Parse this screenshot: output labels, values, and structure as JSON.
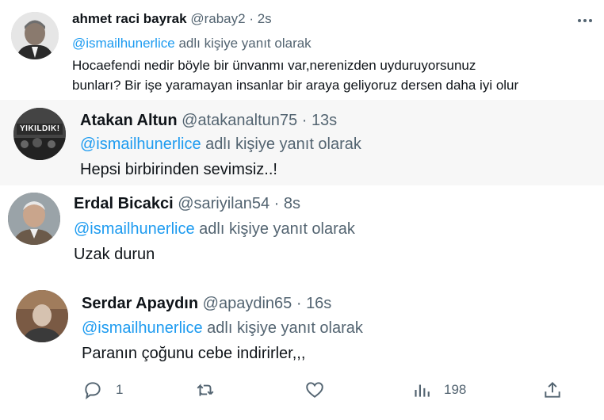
{
  "posts": [
    {
      "name": "ahmet raci bayrak",
      "handle": "@rabay2",
      "time": "2s",
      "reply_to": "@ismailhunerlice",
      "reply_suffix": "adlı kişiye yanıt olarak",
      "text_lines": [
        "Hocaefendi nedir böyle bir ünvanmı var,nerenizden uyduruyorsunuz",
        "bunları? Bir işe yaramayan insanlar bir araya geliyoruz dersen daha iyi olur"
      ]
    },
    {
      "name": "Atakan Altun",
      "handle": "@atakanaltun75",
      "time": "13s",
      "reply_to": "@ismailhunerlice",
      "reply_suffix": "adlı kişiye yanıt olarak",
      "avatar_text": "YIKILDIK!",
      "text_lines": [
        "Hepsi birbirinden sevimsiz..!"
      ]
    },
    {
      "name": "Erdal Bicakci",
      "handle": "@sariyilan54",
      "time": "8s",
      "reply_to": "@ismailhunerlice",
      "reply_suffix": "adlı kişiye yanıt olarak",
      "text_lines": [
        "Uzak durun"
      ]
    },
    {
      "name": "Serdar Apaydın",
      "handle": "@apaydin65",
      "time": "16s",
      "reply_to": "@ismailhunerlice",
      "reply_suffix": "adlı kişiye yanıt olarak",
      "text_lines": [
        "Paranın çoğunu cebe indirirler,,,"
      ]
    }
  ],
  "separator": "·",
  "actions": {
    "reply_count": "1",
    "views_count": "198",
    "icons": [
      "reply-icon",
      "retweet-icon",
      "like-icon",
      "views-icon",
      "share-icon"
    ]
  },
  "colors": {
    "accent": "#1d9bf0",
    "secondary_text": "#536471",
    "primary_text": "#0f1419",
    "post2_bg": "#f7f7f7"
  }
}
